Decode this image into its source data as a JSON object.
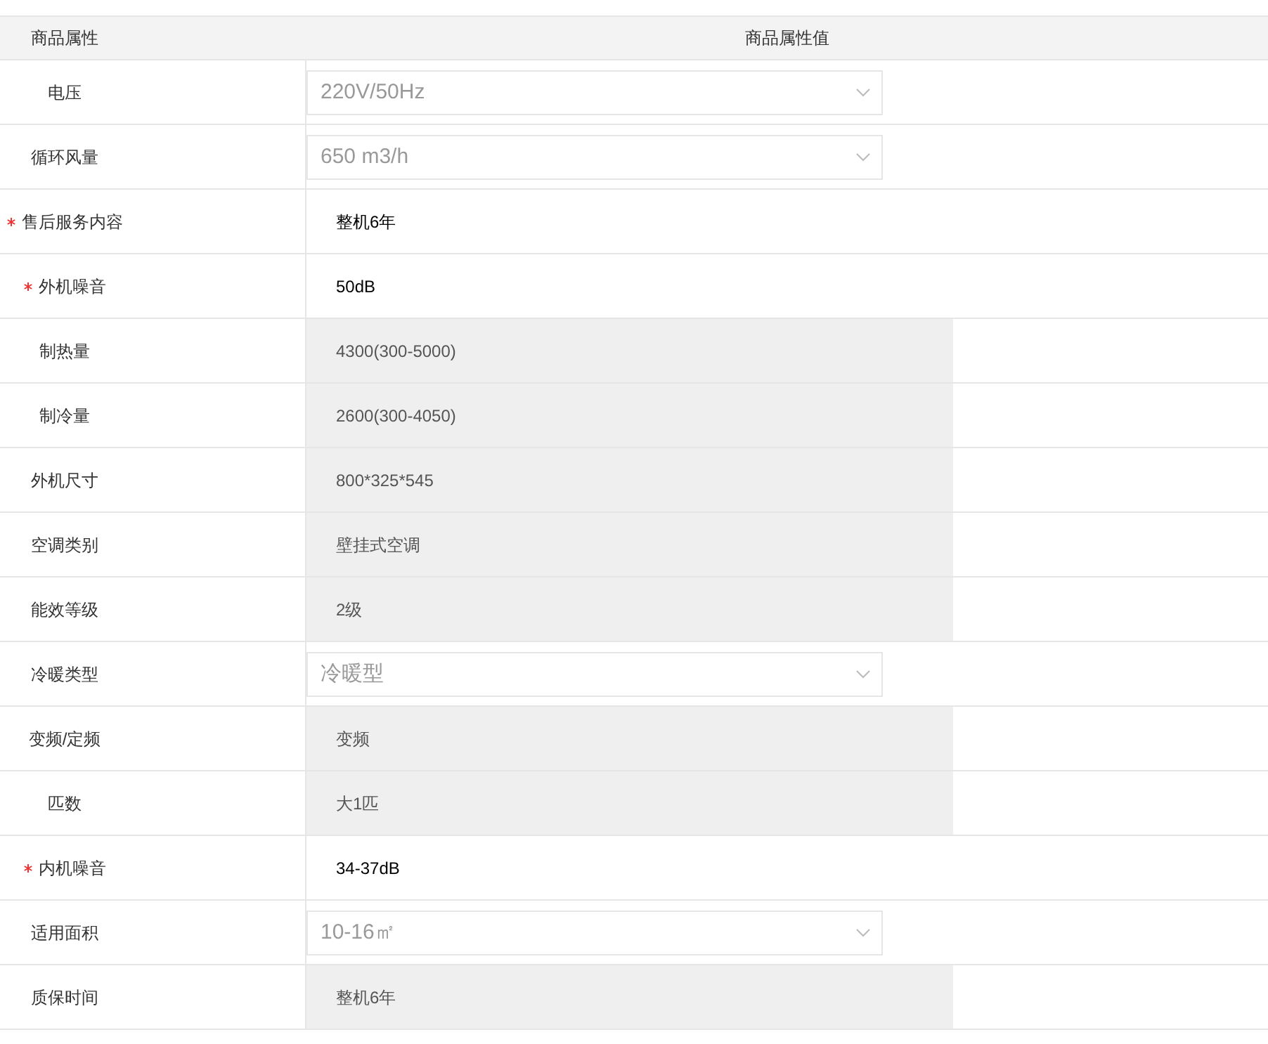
{
  "header": {
    "column_1": "商品属性",
    "column_2": "商品属性值"
  },
  "rows": [
    {
      "label": "电压",
      "required": false,
      "kind": "select",
      "value": "220V/50Hz"
    },
    {
      "label": "循环风量",
      "required": false,
      "kind": "select",
      "value": "650 m3/h"
    },
    {
      "label": "售后服务内容",
      "required": true,
      "kind": "text",
      "value": "整机6年"
    },
    {
      "label": "外机噪音",
      "required": true,
      "kind": "text",
      "value": "50dB"
    },
    {
      "label": "制热量",
      "required": false,
      "kind": "readonly",
      "value": "4300(300-5000)"
    },
    {
      "label": "制冷量",
      "required": false,
      "kind": "readonly",
      "value": "2600(300-4050)"
    },
    {
      "label": "外机尺寸",
      "required": false,
      "kind": "readonly",
      "value": "800*325*545"
    },
    {
      "label": "空调类别",
      "required": false,
      "kind": "readonly",
      "value": "壁挂式空调"
    },
    {
      "label": "能效等级",
      "required": false,
      "kind": "readonly",
      "value": "2级"
    },
    {
      "label": "冷暖类型",
      "required": false,
      "kind": "select",
      "value": "冷暖型"
    },
    {
      "label": "变频/定频",
      "required": false,
      "kind": "readonly",
      "value": "变频"
    },
    {
      "label": "匹数",
      "required": false,
      "kind": "readonly",
      "value": "大1匹"
    },
    {
      "label": "内机噪音",
      "required": true,
      "kind": "text",
      "value": "34-37dB"
    },
    {
      "label": "适用面积",
      "required": false,
      "kind": "select",
      "value": "10-16㎡"
    },
    {
      "label": "质保时间",
      "required": false,
      "kind": "readonly",
      "value": "整机6年"
    }
  ]
}
